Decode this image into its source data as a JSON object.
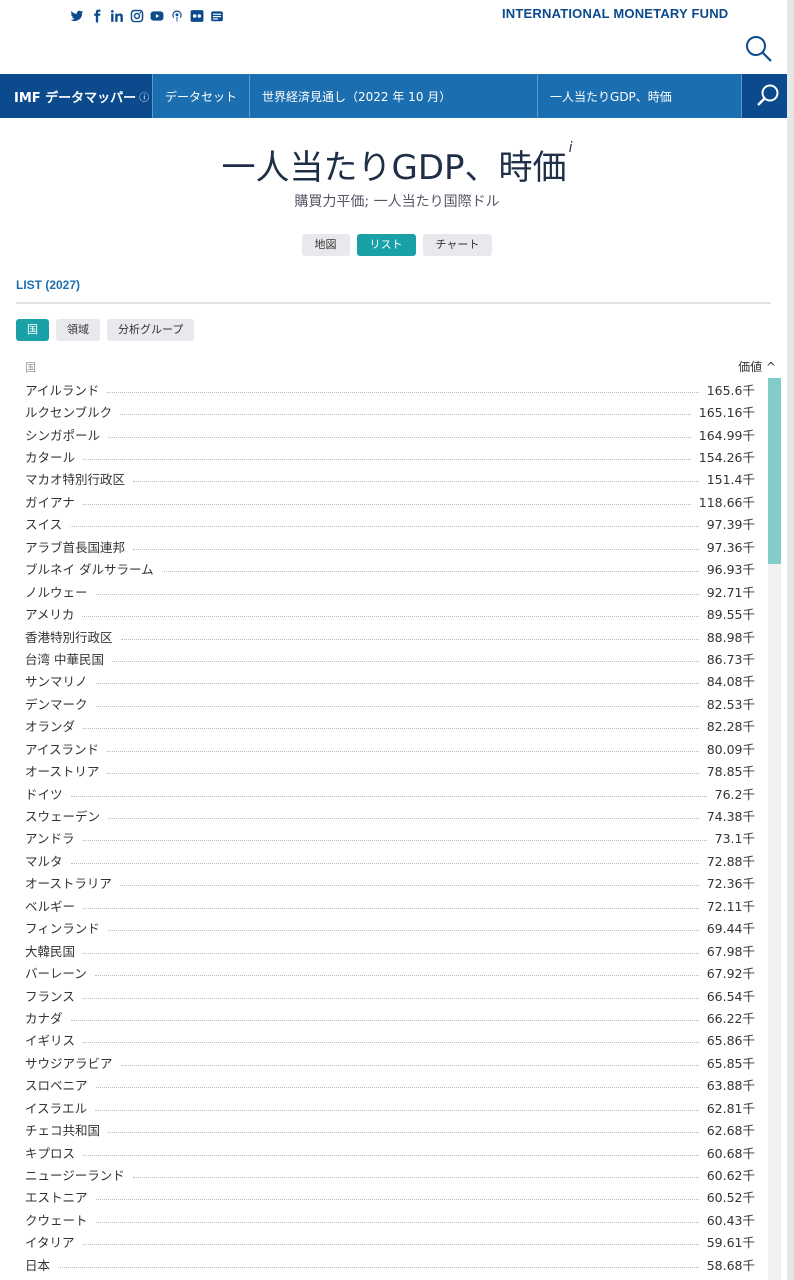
{
  "header": {
    "org_name": "INTERNATIONAL MONETARY FUND",
    "social_icons": [
      "twitter-icon",
      "facebook-icon",
      "linkedin-icon",
      "instagram-icon",
      "youtube-icon",
      "podcast-icon",
      "flickr-icon",
      "newsletter-icon"
    ]
  },
  "nav": {
    "brand": "IMF データマッパー",
    "brand_info": "ⓘ",
    "datasets": "データセット",
    "dataset_name": "世界経済見通し（2022 年 10 月）",
    "indicator": "一人当たりGDP、時価"
  },
  "page": {
    "title": "一人当たりGDP、時価",
    "title_info": "i",
    "subtitle": "購買力平価; 一人当たり国際ドル"
  },
  "views": {
    "map": "地図",
    "list": "リスト",
    "chart": "チャート"
  },
  "list": {
    "heading": "LIST (2027)",
    "groups": {
      "country": "国",
      "region": "領域",
      "analytic": "分析グループ"
    },
    "col_country": "国",
    "col_value": "価値 ^",
    "rows": [
      {
        "name": "アイルランド",
        "value": "165.6千"
      },
      {
        "name": "ルクセンブルク",
        "value": "165.16千"
      },
      {
        "name": "シンガポール",
        "value": "164.99千"
      },
      {
        "name": "カタール",
        "value": "154.26千"
      },
      {
        "name": "マカオ特別行政区",
        "value": "151.4千"
      },
      {
        "name": "ガイアナ",
        "value": "118.66千"
      },
      {
        "name": "スイス",
        "value": "97.39千"
      },
      {
        "name": "アラブ首長国連邦",
        "value": "97.36千"
      },
      {
        "name": "ブルネイ ダルサラーム",
        "value": "96.93千"
      },
      {
        "name": "ノルウェー",
        "value": "92.71千"
      },
      {
        "name": "アメリカ",
        "value": "89.55千"
      },
      {
        "name": "香港特別行政区",
        "value": "88.98千"
      },
      {
        "name": "台湾 中華民国",
        "value": "86.73千"
      },
      {
        "name": "サンマリノ",
        "value": "84.08千"
      },
      {
        "name": "デンマーク",
        "value": "82.53千"
      },
      {
        "name": "オランダ",
        "value": "82.28千"
      },
      {
        "name": "アイスランド",
        "value": "80.09千"
      },
      {
        "name": "オーストリア",
        "value": "78.85千"
      },
      {
        "name": "ドイツ",
        "value": "76.2千"
      },
      {
        "name": "スウェーデン",
        "value": "74.38千"
      },
      {
        "name": "アンドラ",
        "value": "73.1千"
      },
      {
        "name": "マルタ",
        "value": "72.88千"
      },
      {
        "name": "オーストラリア",
        "value": "72.36千"
      },
      {
        "name": "ベルギー",
        "value": "72.11千"
      },
      {
        "name": "フィンランド",
        "value": "69.44千"
      },
      {
        "name": "大韓民国",
        "value": "67.98千"
      },
      {
        "name": "バーレーン",
        "value": "67.92千"
      },
      {
        "name": "フランス",
        "value": "66.54千"
      },
      {
        "name": "カナダ",
        "value": "66.22千"
      },
      {
        "name": "イギリス",
        "value": "65.86千"
      },
      {
        "name": "サウジアラビア",
        "value": "65.85千"
      },
      {
        "name": "スロベニア",
        "value": "63.88千"
      },
      {
        "name": "イスラエル",
        "value": "62.81千"
      },
      {
        "name": "チェコ共和国",
        "value": "62.68千"
      },
      {
        "name": "キプロス",
        "value": "60.68千"
      },
      {
        "name": "ニュージーランド",
        "value": "60.62千"
      },
      {
        "name": "エストニア",
        "value": "60.52千"
      },
      {
        "name": "クウェート",
        "value": "60.43千"
      },
      {
        "name": "イタリア",
        "value": "59.61千"
      },
      {
        "name": "日本",
        "value": "58.68千"
      }
    ]
  },
  "colors": {
    "primary_blue": "#1b6fb0",
    "dark_blue": "#0b4a8c",
    "teal": "#1aa1a8"
  }
}
